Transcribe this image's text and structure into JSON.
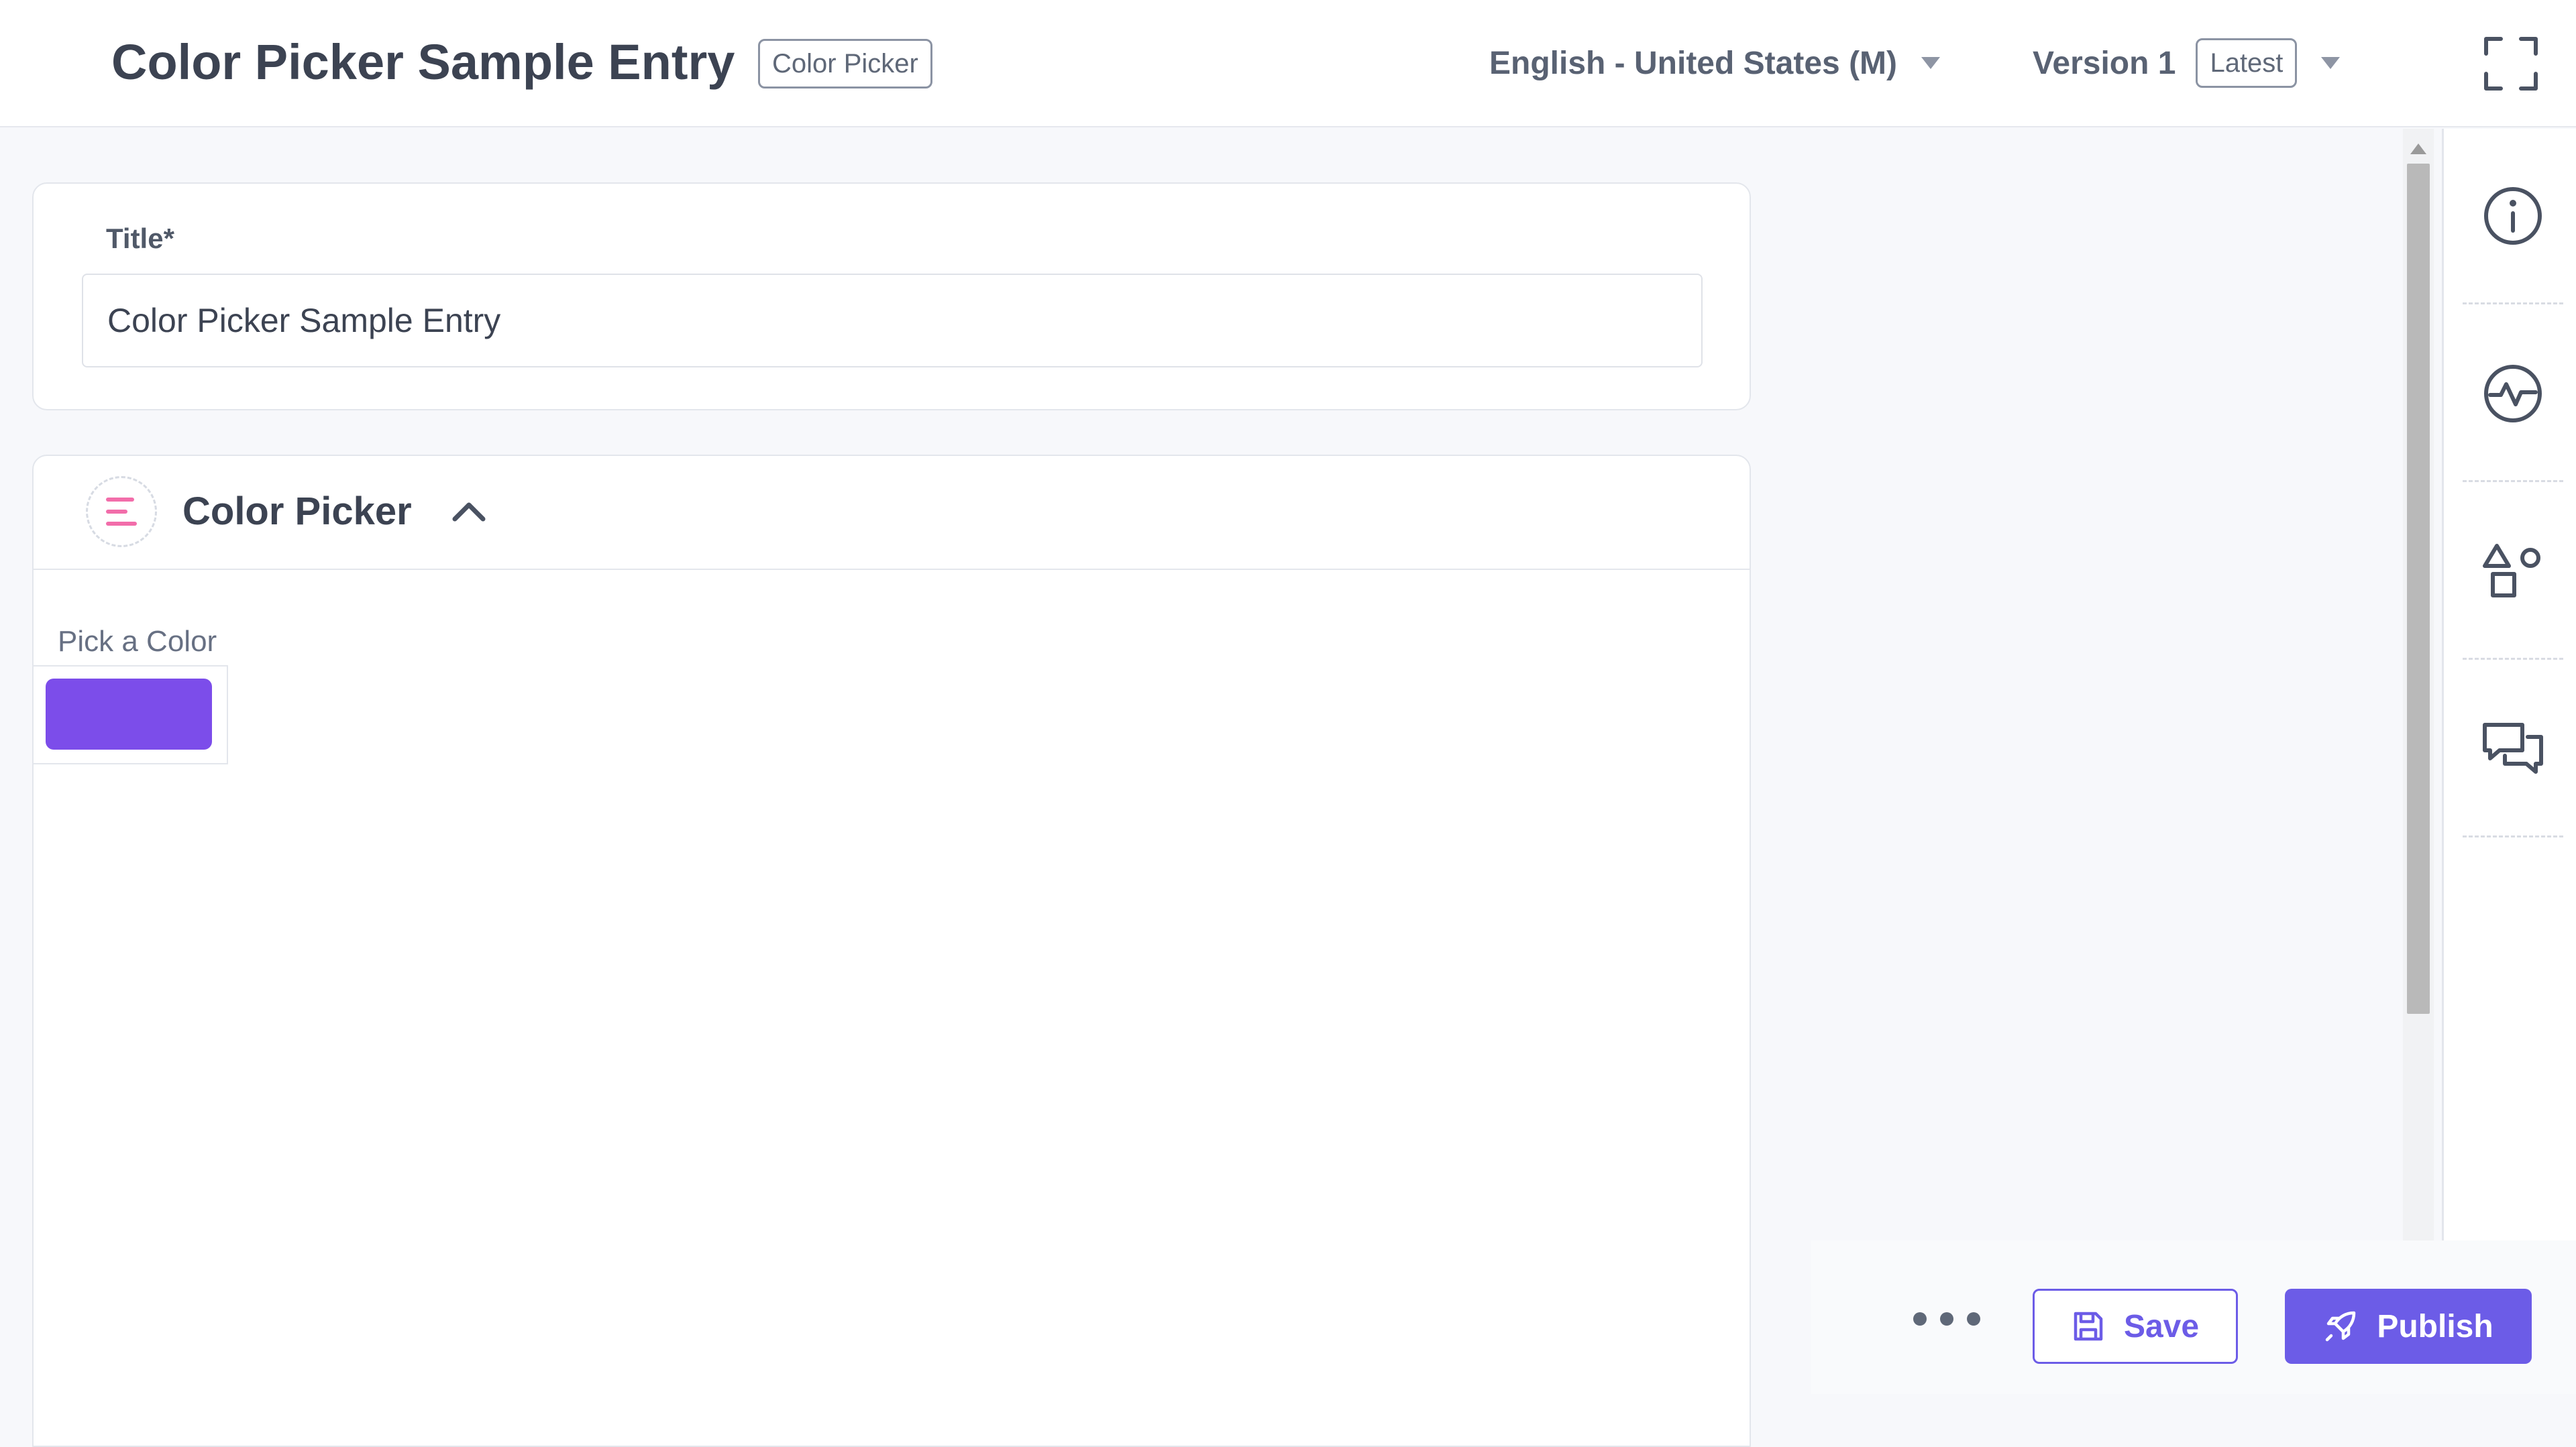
{
  "header": {
    "entry_title": "Color Picker Sample Entry",
    "content_type_badge": "Color Picker",
    "locale": "English - United States (M)",
    "version": "Version 1",
    "version_badge": "Latest"
  },
  "title_field": {
    "label": "Title*",
    "value": "Color Picker Sample Entry"
  },
  "group": {
    "title": "Color Picker",
    "field_label": "Pick a Color",
    "swatch_color": "#7c4dea"
  },
  "rail": {
    "icons": [
      "info-icon",
      "activity-icon",
      "shapes-icon",
      "comments-icon"
    ]
  },
  "actions": {
    "save_label": "Save",
    "publish_label": "Publish"
  },
  "colors": {
    "accent": "#6c5ce7",
    "swatch": "#7c4dea",
    "brand_pink": "#f26daa"
  }
}
